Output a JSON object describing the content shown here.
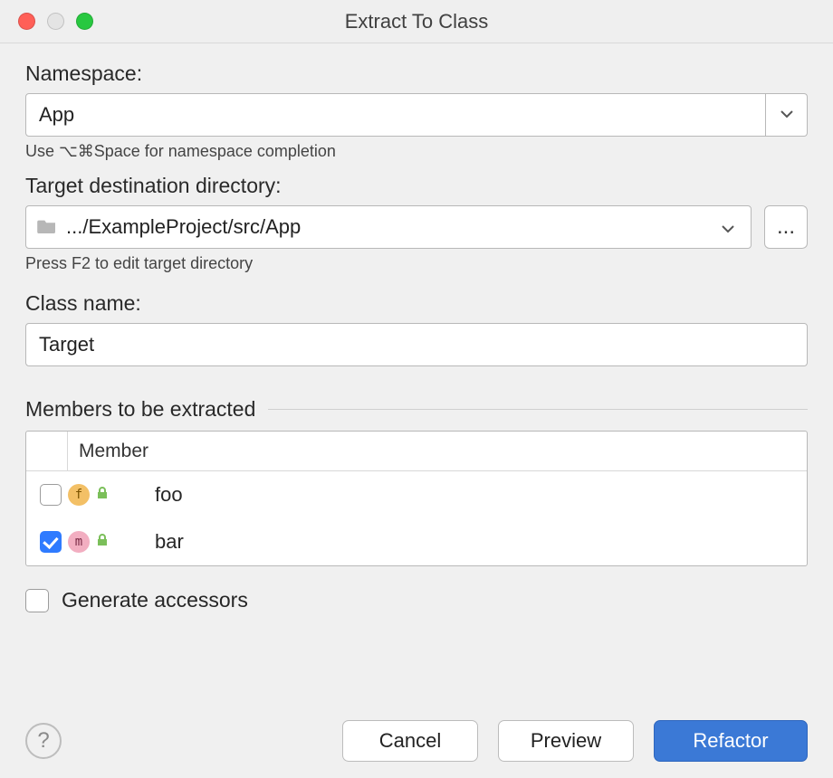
{
  "window": {
    "title": "Extract To Class"
  },
  "namespace": {
    "label": "Namespace:",
    "value": "App",
    "hint": "Use ⌥⌘Space for namespace completion"
  },
  "directory": {
    "label": "Target destination directory:",
    "path": ".../ExampleProject/src/App",
    "hint": "Press F2 to edit target directory",
    "browse_label": "..."
  },
  "class_name": {
    "label": "Class name:",
    "value": "Target"
  },
  "members": {
    "section_title": "Members to be extracted",
    "column_header": "Member",
    "rows": [
      {
        "checked": false,
        "kind": "f",
        "name": "foo"
      },
      {
        "checked": true,
        "kind": "m",
        "name": "bar"
      }
    ]
  },
  "generate_accessors": {
    "label": "Generate accessors",
    "checked": false
  },
  "buttons": {
    "help": "?",
    "cancel": "Cancel",
    "preview": "Preview",
    "refactor": "Refactor"
  }
}
